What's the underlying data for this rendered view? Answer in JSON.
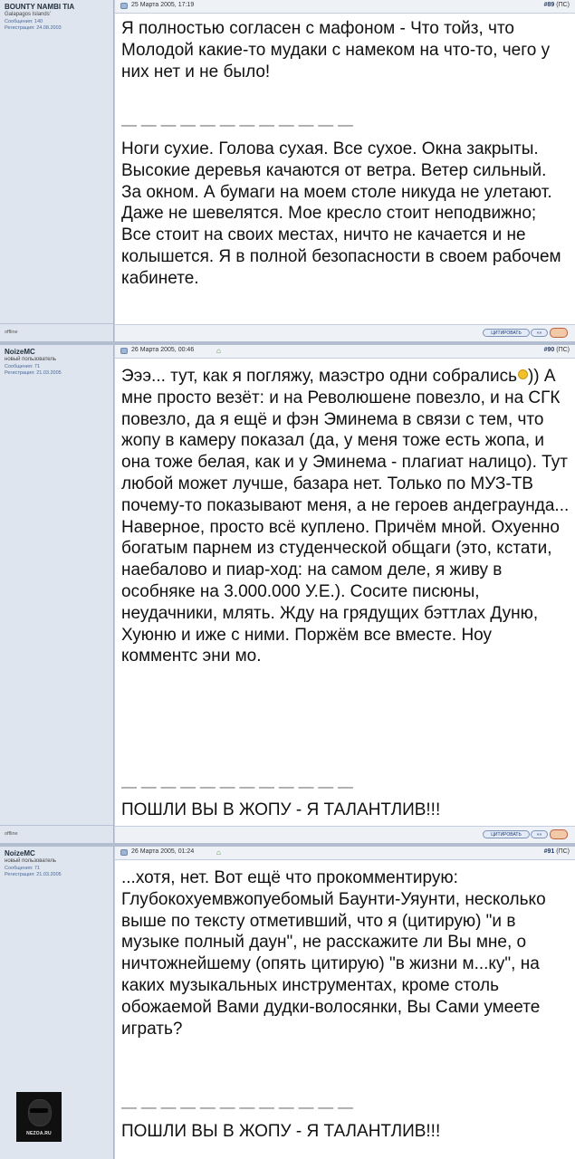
{
  "posts": [
    {
      "author": "BOUNTY NAMBI TIA",
      "rank": "Galapagos Islands'",
      "messages": "Сообщения: 140",
      "registered": "Регистрация: 24.08.2003",
      "status": "offline",
      "date": "25 Марта 2005, 17:19",
      "number": "#89",
      "number_suffix": " (ПС)",
      "paragraphs": [
        "Я полностью согласен с мафоном - Что тойз, что Молодой какие-то мудаки с намеком на что-то, чего у них нет и не было!"
      ],
      "signature_dashes": "— — — — — — — — — — — —",
      "signature": "Ноги сухие. Голова сухая. Все сухое. Окна закрыты. Высокие деревья качаются от ветра. Ветер сильный. За окном. А бумаги на моем столе никуда не улетают. Даже не шевелятся. Мое кресло стоит неподвижно; Все стоит на своих местах, ничто не качается и не колышется. Я в полной безопасности в своем рабочем кабинете.",
      "quote_label": "ЦИТИРОВАТЬ",
      "small_label": "«»"
    },
    {
      "author": "NoizeMC",
      "rank": "новый пользователь",
      "messages": "Сообщения: 71",
      "registered": "Регистрация: 21.03.2005",
      "status": "offline",
      "date": "26 Марта 2005, 00:46",
      "home_icon": "⌂",
      "number": "#90",
      "number_suffix": " (ПС)",
      "text_before_smiley": "Эээ... тут, как я погляжу, маэстро одни собрались",
      "text_after_smiley": ")) А мне просто везёт: и на Революшене повезло, и на СГК повезло, да я ещё и фэн Эминема в связи с тем, что жопу в камеру показал (да, у меня тоже есть жопа, и она тоже белая, как и у Эминема - плагиат налицо). Тут любой может лучше, базара нет. Только по МУЗ-ТВ почему-то показывают меня, а не героев андеграунда... Наверное, просто всё куплено. Причём мной. Охуенно богатым парнем из студенческой общаги (это, кстати, наебалово и пиар-ход: на самом деле, я живу в особняке на 3.000.000 У.Е.). Сосите писюны, неудачники, млять. Жду на грядущих бэттлах Дуню, Хуюню и иже с ними. Поржём все вместе. Ноу комментс эни мо.",
      "signature_dashes": "— — — — — — — — — — — —",
      "signature": "ПОШЛИ ВЫ В ЖОПУ - Я ТАЛАНТЛИВ!!!",
      "quote_label": "ЦИТИРОВАТЬ",
      "small_label": "«»"
    },
    {
      "author": "NoizeMC",
      "rank": "новый пользователь",
      "messages": "Сообщения: 71",
      "registered": "Регистрация: 21.03.2005",
      "date": "26 Марта 2005, 01:24",
      "home_icon": "⌂",
      "number": "#91",
      "number_suffix": " (ПС)",
      "text": "...хотя, нет. Вот ещё что прокомментирую: Глубокохуемвжопуебомый Баунти-Уяунти, несколько выше по тексту отметивший, что я (цитирую) \"и в музыке полный даун\", не расскажите ли Вы мне, о ничтожнейшему (опять цитирую) \"в жизни м...ку\", на каких музыкальных инструментах, кроме столь обожаемой Вами дудки-волосянки, Вы Сами умеете играть?",
      "signature_dashes": "— — — — — — — — — — — —",
      "signature": "ПОШЛИ ВЫ В ЖОПУ - Я ТАЛАНТЛИВ!!!",
      "avatar_label": "NEZOA.RU"
    }
  ]
}
